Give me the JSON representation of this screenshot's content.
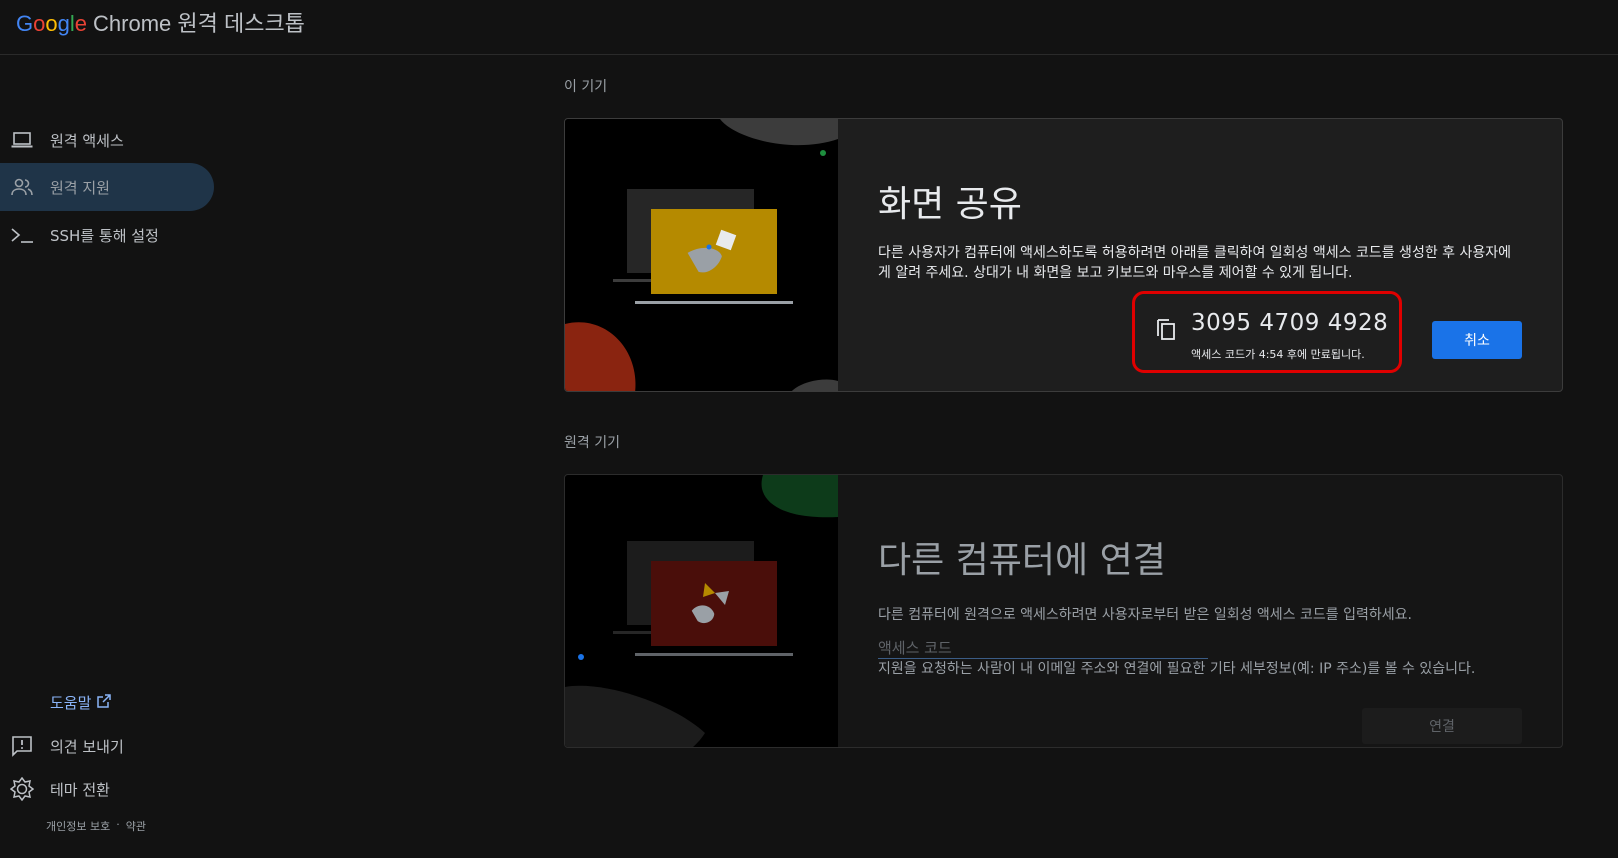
{
  "app": {
    "title_rest": "Chrome 원격 데스크톱",
    "logo_g": "G",
    "logo_o1": "o",
    "logo_o2": "o",
    "logo_g2": "g",
    "logo_l": "l",
    "logo_e": "e"
  },
  "sidebar": {
    "items": [
      {
        "label": "원격 액세스",
        "icon": "laptop-icon"
      },
      {
        "label": "원격 지원",
        "icon": "people-icon",
        "active": true
      },
      {
        "label": "SSH를 통해 설정",
        "icon": "terminal-icon"
      }
    ],
    "help": "도움말",
    "feedback": "의견 보내기",
    "theme": "테마 전환",
    "privacy": "개인정보 보호",
    "separator": "·",
    "terms": "약관"
  },
  "this_device": {
    "section_title": "이 기기",
    "title": "화면 공유",
    "description": "다른 사용자가 컴퓨터에 액세스하도록 허용하려면 아래를 클릭하여 일회성 액세스 코드를 생성한 후 사용자에게 알려 주세요. 상대가 내 화면을 보고 키보드와 마우스를 제어할 수 있게 됩니다.",
    "access_code": "3095 4709 4928",
    "expire_prefix": "액세스 코드가 ",
    "expire_time": "4:54",
    "expire_suffix": " 후에 만료됩니다.",
    "cancel_label": "취소"
  },
  "remote_device": {
    "section_title": "원격 기기",
    "title": "다른 컴퓨터에 연결",
    "description": "다른 컴퓨터에 원격으로 액세스하려면 사용자로부터 받은 일회성 액세스 코드를 입력하세요.",
    "input_placeholder": "액세스 코드",
    "note": "지원을 요청하는 사람이 내 이메일 주소와 연결에 필요한 기타 세부정보(예: IP 주소)를 볼 수 있습니다.",
    "connect_label": "연결"
  },
  "colors": {
    "accent": "#1a73e8",
    "highlight_border": "#e00000",
    "share_art": "#b58a00",
    "connect_art": "#4a0e0a"
  }
}
